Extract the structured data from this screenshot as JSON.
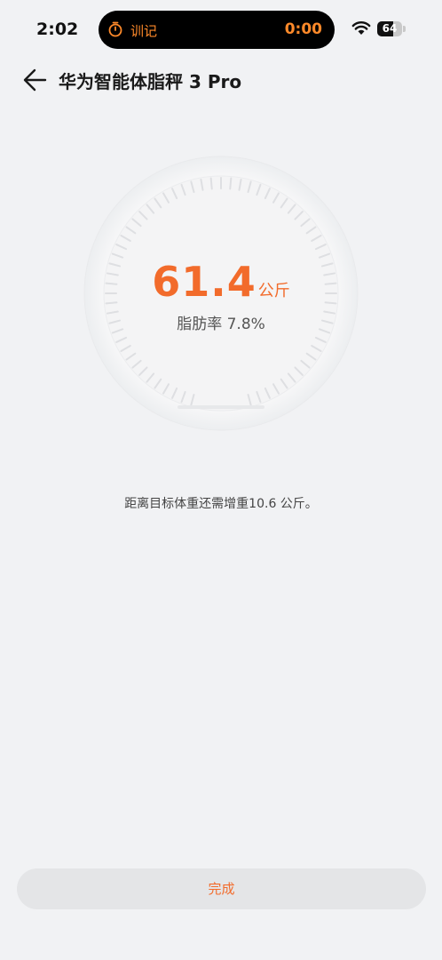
{
  "status_bar": {
    "time": "2:02",
    "activity_label": "训记",
    "activity_time": "0:00",
    "battery_level": "64",
    "accent_color": "#ff8a2a"
  },
  "header": {
    "title": "华为智能体脂秤 3 Pro"
  },
  "measurement": {
    "weight_value": "61.4",
    "weight_unit": "公斤",
    "body_fat": "脂肪率 7.8%",
    "accent_color": "#f26b2b"
  },
  "goal": {
    "message": "距离目标体重还需增重10.6 公斤。"
  },
  "actions": {
    "done_label": "完成"
  }
}
